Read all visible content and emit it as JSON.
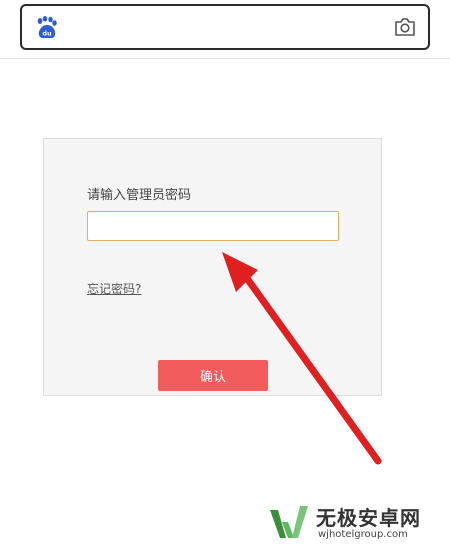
{
  "search_bar": {
    "logo_icon": "baidu-paw-icon",
    "logo_text": "du",
    "camera_icon": "camera-icon",
    "input_value": ""
  },
  "login": {
    "prompt": "请输入管理员密码",
    "password_value": "",
    "forgot_link": "忘记密码?",
    "confirm_label": "确认"
  },
  "watermark": {
    "title": "无极安卓网",
    "url": "wjhotelgroup.com"
  },
  "colors": {
    "confirm_button": "#f25c5c",
    "arrow": "#e02020",
    "logo_blue": "#2e5cd8",
    "watermark_green": "#4caf50"
  }
}
